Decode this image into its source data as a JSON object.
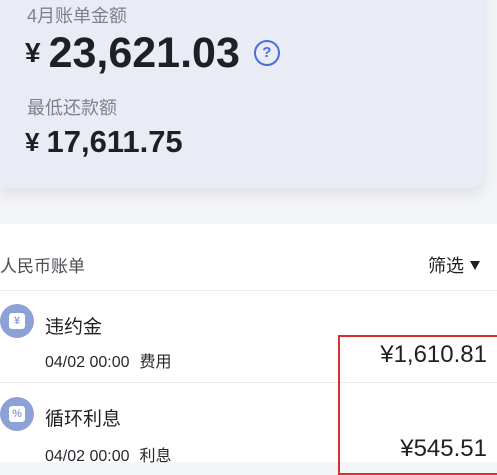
{
  "summary": {
    "bill_label": "4月账单金额",
    "bill_currency": "¥",
    "bill_amount": "23,621.03",
    "help_icon": "question-circle-icon",
    "min_label": "最低还款额",
    "min_currency": "¥",
    "min_amount": "17,611.75"
  },
  "list": {
    "header": "人民币账单",
    "filter_label": "筛选",
    "filter_icon": "triangle-down-icon",
    "items": [
      {
        "icon": "yen-bill-icon",
        "icon_glyph": "¥",
        "name": "违约金",
        "datetime": "04/02 00:00",
        "type": "费用",
        "amount": "¥1,610.81"
      },
      {
        "icon": "percent-icon",
        "icon_glyph": "%",
        "name": "循环利息",
        "datetime": "04/02 00:00",
        "type": "利息",
        "amount": "¥545.51"
      }
    ]
  },
  "colors": {
    "accent": "#4a6ee0",
    "highlight": "#d93030",
    "icon_bg": "#8ea0d8",
    "card_bg": "#e9ebf5"
  }
}
